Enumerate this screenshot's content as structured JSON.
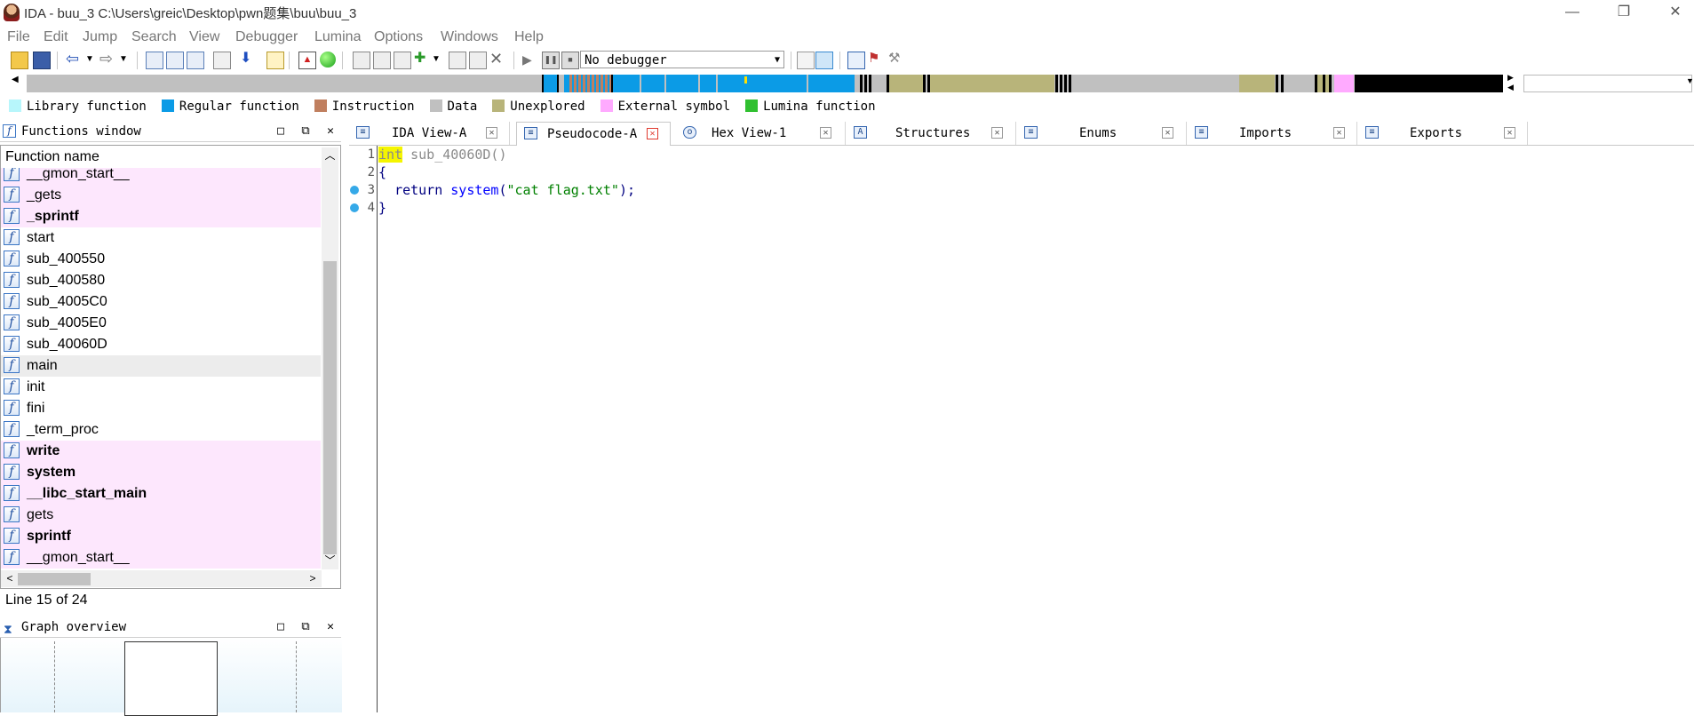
{
  "window": {
    "title": "IDA - buu_3 C:\\Users\\greic\\Desktop\\pwn题集\\buu\\buu_3",
    "minimize": "—",
    "restore": "❐",
    "close": "✕"
  },
  "menu": [
    "File",
    "Edit",
    "Jump",
    "Search",
    "View",
    "Debugger",
    "Lumina",
    "Options",
    "Windows",
    "Help"
  ],
  "toolbar": {
    "debugger_select": "No debugger"
  },
  "legend": [
    {
      "label": "Library function",
      "color": "#b7f6fb"
    },
    {
      "label": "Regular function",
      "color": "#0b9be6"
    },
    {
      "label": "Instruction",
      "color": "#c07f5f"
    },
    {
      "label": "Data",
      "color": "#c0c0c0"
    },
    {
      "label": "Unexplored",
      "color": "#b8b47a"
    },
    {
      "label": "External symbol",
      "color": "#ffaaff"
    },
    {
      "label": "Lumina function",
      "color": "#30c030"
    }
  ],
  "functions_window": {
    "title": "Functions window",
    "column_header": "Function name",
    "status": "Line 15 of 24",
    "rows": [
      {
        "name": "__gmon_start__",
        "ext": true,
        "bold": false
      },
      {
        "name": "_gets",
        "ext": true,
        "bold": false
      },
      {
        "name": "_sprintf",
        "ext": true,
        "bold": true
      },
      {
        "name": "start",
        "ext": false,
        "bold": false
      },
      {
        "name": "sub_400550",
        "ext": false,
        "bold": false
      },
      {
        "name": "sub_400580",
        "ext": false,
        "bold": false
      },
      {
        "name": "sub_4005C0",
        "ext": false,
        "bold": false
      },
      {
        "name": "sub_4005E0",
        "ext": false,
        "bold": false
      },
      {
        "name": "sub_40060D",
        "ext": false,
        "bold": false
      },
      {
        "name": "main",
        "ext": false,
        "bold": false,
        "selected": true
      },
      {
        "name": "init",
        "ext": false,
        "bold": false
      },
      {
        "name": "fini",
        "ext": false,
        "bold": false
      },
      {
        "name": "_term_proc",
        "ext": false,
        "bold": false
      },
      {
        "name": "write",
        "ext": true,
        "bold": true
      },
      {
        "name": "system",
        "ext": true,
        "bold": true
      },
      {
        "name": "__libc_start_main",
        "ext": true,
        "bold": true
      },
      {
        "name": "gets",
        "ext": true,
        "bold": false
      },
      {
        "name": "sprintf",
        "ext": true,
        "bold": true
      },
      {
        "name": "__gmon_start__",
        "ext": true,
        "bold": false
      }
    ]
  },
  "graph_overview": {
    "title": "Graph overview"
  },
  "pane_buttons": {
    "float": "□",
    "dock": "⧉",
    "close": "✕"
  },
  "tabs": [
    {
      "label": "IDA View-A",
      "icon": "ida-view-icon",
      "active": false
    },
    {
      "label": "Pseudocode-A",
      "icon": "pseudocode-icon",
      "active": true
    },
    {
      "label": "Hex View-1",
      "icon": "hex-view-icon",
      "active": false
    },
    {
      "label": "Structures",
      "icon": "structures-icon",
      "active": false
    },
    {
      "label": "Enums",
      "icon": "enums-icon",
      "active": false
    },
    {
      "label": "Imports",
      "icon": "imports-icon",
      "active": false
    },
    {
      "label": "Exports",
      "icon": "exports-icon",
      "active": false
    }
  ],
  "code": {
    "line_numbers": [
      "1",
      "2",
      "3",
      "4"
    ],
    "line1_type": "int",
    "line1_rest": " sub_40060D()",
    "line2": "{",
    "line3_kw": "return",
    "line3_fn": "system",
    "line3_open": "(",
    "line3_str": "\"cat flag.txt\"",
    "line3_close": ");",
    "line4": "}"
  }
}
